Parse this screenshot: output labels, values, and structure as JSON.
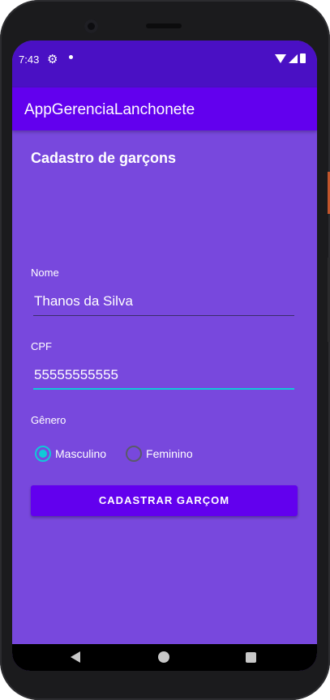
{
  "status": {
    "time": "7:43",
    "icons": [
      "settings-icon",
      "notification-dot",
      "wifi-icon",
      "signal-icon",
      "battery-icon"
    ]
  },
  "appbar": {
    "title": "AppGerenciaLanchonete"
  },
  "form": {
    "title": "Cadastro de garçons",
    "name_label": "Nome",
    "name_value": "Thanos da Silva",
    "cpf_label": "CPF",
    "cpf_value": "55555555555",
    "gender_label": "Gênero",
    "gender_options": [
      {
        "label": "Masculino",
        "selected": true
      },
      {
        "label": "Feminino",
        "selected": false
      }
    ],
    "submit_label": "CADASTRAR GARÇOM"
  },
  "colors": {
    "status_bar": "#4a10c4",
    "app_bar": "#6200ee",
    "background": "#7848dd",
    "accent": "#10c9d8"
  },
  "navbar": {
    "icons": [
      "back-icon",
      "home-icon",
      "recents-icon"
    ]
  }
}
